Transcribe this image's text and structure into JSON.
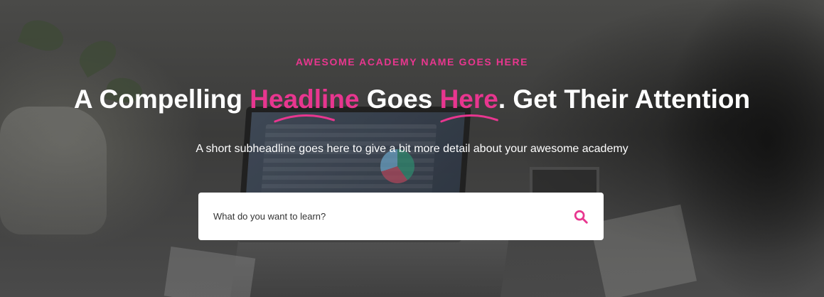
{
  "hero": {
    "eyebrow": "AWESOME ACADEMY NAME GOES HERE",
    "headline": {
      "part1": "A Compelling ",
      "highlight1": "Headline",
      "part2": " Goes ",
      "highlight2": "Here",
      "part3": ". Get Their Attention"
    },
    "subheadline": "A short subheadline goes here to give a bit more detail about your awesome academy"
  },
  "search": {
    "placeholder": "What do you want to learn?",
    "icon": "search-icon"
  },
  "colors": {
    "accent": "#e8368f",
    "text": "#ffffff",
    "search_background": "#ffffff"
  }
}
